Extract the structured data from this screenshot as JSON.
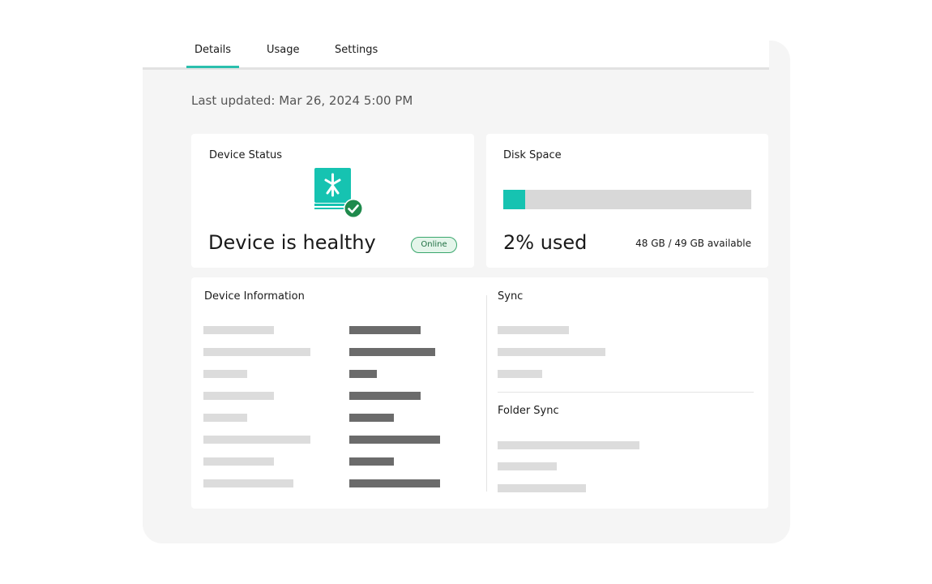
{
  "tabs": [
    {
      "label": "Details",
      "active": true
    },
    {
      "label": "Usage",
      "active": false
    },
    {
      "label": "Settings",
      "active": false
    }
  ],
  "last_updated": "Last updated: Mar 26, 2024 5:00 PM",
  "device_status": {
    "title": "Device Status",
    "icon": "device-healthy-icon",
    "headline": "Device is healthy",
    "badge": "Online"
  },
  "disk_space": {
    "title": "Disk Space",
    "used_fraction": 0.02,
    "used_label": "2% used",
    "available_label": "48 GB / 49 GB available"
  },
  "device_information": {
    "title": "Device Information"
  },
  "sync": {
    "title": "Sync",
    "folder_sync_title": "Folder Sync"
  },
  "colors": {
    "accent": "#2bbfad",
    "disk_fill": "#16c3b1",
    "online_border": "#3aa76d",
    "check_badge": "#1f8a4c"
  }
}
